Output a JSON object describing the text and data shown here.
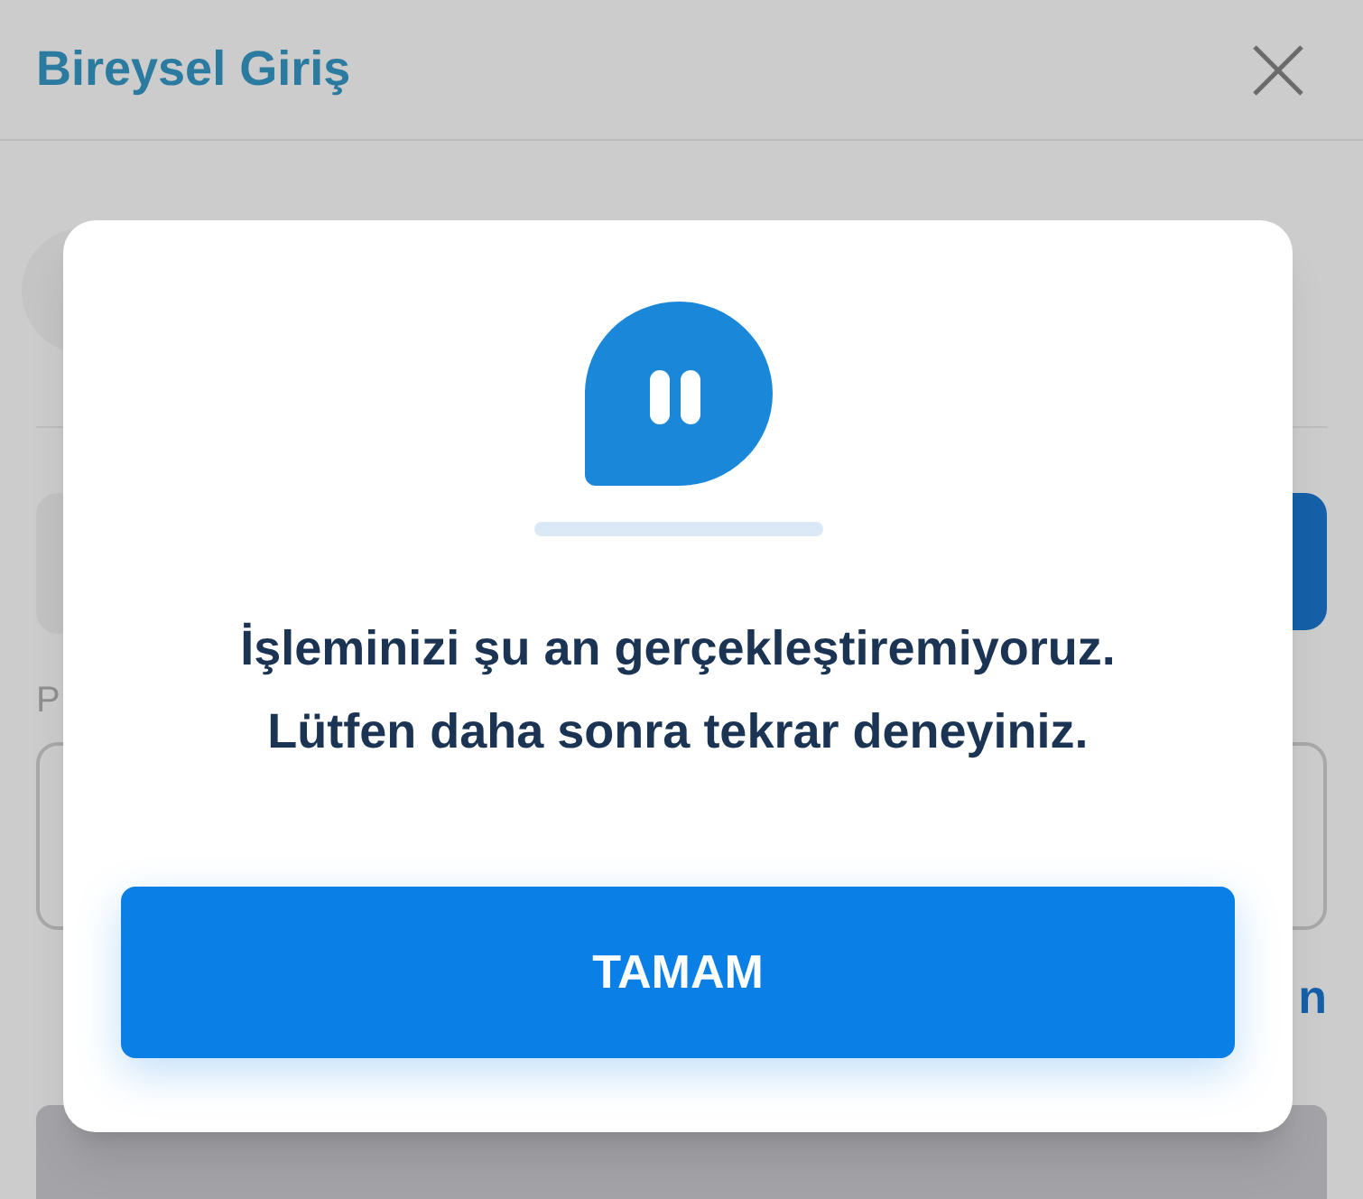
{
  "header": {
    "title": "Bireysel Giriş"
  },
  "form": {
    "field_label": "P",
    "link_fragment": "n"
  },
  "dialog": {
    "message_lines": [
      "İşleminizi şu an gerçekleştiremiyoruz.",
      "Lütfen daha sonra tekrar deneyiniz."
    ],
    "button": "TAMAM"
  }
}
